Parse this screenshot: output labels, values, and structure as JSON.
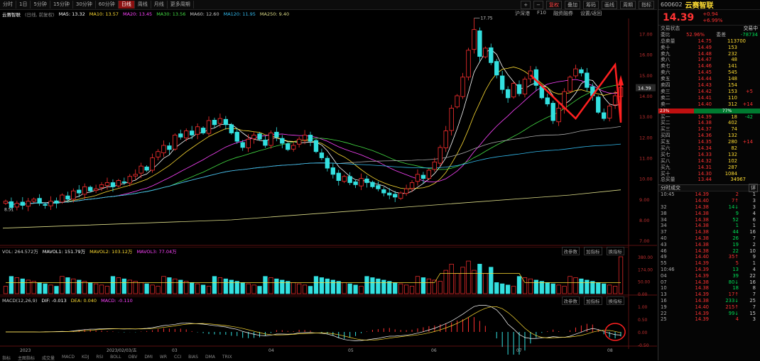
{
  "toolbar": {
    "timeframes": [
      "分时",
      "1日",
      "5分钟",
      "15分钟",
      "30分钟",
      "60分钟",
      "日线",
      "周线",
      "月线",
      "更多周期"
    ],
    "active": "日线",
    "right_buttons": [
      "+",
      "−",
      "复权",
      "叠加",
      "筹码",
      "画线",
      "周期",
      "指标"
    ]
  },
  "sub_tabs": [
    "沪深港",
    "F10",
    "融资融券",
    "设置/返回"
  ],
  "ma_bar": {
    "name": "云赛智联",
    "mode": "(日线, 前复权)",
    "items": [
      {
        "label": "MA5: 13.32",
        "color": "#ffffff"
      },
      {
        "label": "MA10: 13.57",
        "color": "#ffdd33"
      },
      {
        "label": "MA20: 13.45",
        "color": "#ff44ff"
      },
      {
        "label": "MA30: 13.56",
        "color": "#44dd44"
      },
      {
        "label": "MA60: 12.60",
        "color": "#cccccc"
      },
      {
        "label": "MA120: 11.95",
        "color": "#33bbee"
      },
      {
        "label": "MA250: 9.40",
        "color": "#dddd88"
      }
    ]
  },
  "chart_data": {
    "type": "candlestick",
    "price_axis": [
      "17.00",
      "16.00",
      "15.00",
      "14.00",
      "13.00",
      "12.00",
      "11.00",
      "10.00",
      "9.00",
      "8.00",
      "7.00"
    ],
    "ylim": [
      6.8,
      17.6
    ],
    "current_price_label": "14.39",
    "high_label": "17.75",
    "low_marker": "8.51",
    "x_labels": [
      "2023",
      "2023/02/03/五",
      "03",
      "04",
      "05",
      "06",
      "07",
      "08"
    ],
    "closes": [
      8.9,
      8.6,
      8.8,
      8.7,
      8.9,
      9.0,
      8.8,
      8.7,
      8.9,
      8.8,
      9.2,
      9.0,
      9.4,
      9.3,
      9.6,
      9.4,
      9.5,
      9.7,
      9.8,
      9.6,
      9.9,
      9.8,
      10.1,
      10.2,
      10.6,
      10.4,
      11.0,
      11.3,
      11.6,
      11.4,
      12.1,
      12.0,
      12.3,
      12.1,
      12.5,
      12.2,
      12.8,
      12.6,
      12.9,
      12.6,
      12.2,
      11.8,
      11.5,
      11.9,
      12.1,
      11.9,
      11.6,
      12.2,
      12.0,
      11.7,
      11.4,
      11.6,
      11.9,
      12.1,
      11.8,
      11.3,
      11.0,
      10.5,
      10.2,
      9.9,
      10.1,
      9.8,
      9.7,
      10.0,
      9.8,
      9.6,
      9.5,
      9.3,
      9.2,
      9.1,
      9.3,
      9.5,
      9.8,
      10.2,
      10.0,
      10.4,
      10.8,
      11.5,
      12.3,
      13.4,
      14.0,
      14.9,
      16.2,
      17.2,
      15.9,
      16.3,
      15.6,
      15.0,
      14.3,
      13.9,
      14.6,
      14.1,
      14.8,
      15.2,
      14.5,
      13.9,
      13.6,
      12.8,
      13.4,
      14.2,
      14.9,
      15.3,
      15.1,
      14.4,
      14.0,
      13.2,
      12.9,
      13.5,
      14.0,
      14.39
    ],
    "volume_panel": {
      "header": [
        "VOL: 264.572万",
        "MAVOL1: 151.79万",
        "MAVOL2: 103.12万",
        "MAVOL3: 77.04万"
      ],
      "axis": [
        "380.00",
        "174.00",
        "50.00",
        "0.00"
      ]
    },
    "macd_panel": {
      "header": [
        "MACD(12,26,9)",
        "DIF: -0.013",
        "DEA: 0.040",
        "MACD: -0.110"
      ],
      "axis": [
        "1.00",
        "0.50",
        "0.00",
        "-0.50"
      ]
    }
  },
  "panel_buttons": [
    "改参数",
    "加指标",
    "换指标"
  ],
  "bottom_tabs": [
    "指标",
    "主图指标",
    "成交量",
    "MACD",
    "KDJ",
    "RSI",
    "BOLL",
    "OBV",
    "DMI",
    "WR",
    "CCI",
    "BIAS",
    "DMA",
    "TRIX"
  ],
  "right_panel": {
    "code": "600602",
    "name": "云赛智联",
    "price": "14.39",
    "change": "+0.94",
    "change_pct": "+6.99%",
    "status_label": "交易状态",
    "status_value": "交易中",
    "ratio_label": "委比",
    "ratio_value": "52.96%",
    "diff_label": "委差",
    "diff_value": "-78734",
    "sell_total": {
      "label": "总卖量",
      "price": "14.75",
      "vol": "113700"
    },
    "asks": [
      {
        "l": "卖十",
        "p": "14.49",
        "v": "153",
        "c": ""
      },
      {
        "l": "卖九",
        "p": "14.48",
        "v": "232",
        "c": ""
      },
      {
        "l": "卖八",
        "p": "14.47",
        "v": "48",
        "c": ""
      },
      {
        "l": "卖七",
        "p": "14.46",
        "v": "141",
        "c": ""
      },
      {
        "l": "卖六",
        "p": "14.45",
        "v": "545",
        "c": ""
      },
      {
        "l": "卖五",
        "p": "14.44",
        "v": "148",
        "c": ""
      },
      {
        "l": "卖四",
        "p": "14.43",
        "v": "154",
        "c": ""
      },
      {
        "l": "卖三",
        "p": "14.42",
        "v": "153",
        "c": "+5"
      },
      {
        "l": "卖二",
        "p": "14.41",
        "v": "110",
        "c": ""
      },
      {
        "l": "卖一",
        "p": "14.40",
        "v": "312",
        "c": "+14"
      }
    ],
    "bar_left": "23%",
    "bar_right": "77%",
    "bids": [
      {
        "l": "买一",
        "p": "14.39",
        "v": "18",
        "c": "-42"
      },
      {
        "l": "买二",
        "p": "14.38",
        "v": "402",
        "c": ""
      },
      {
        "l": "买三",
        "p": "14.37",
        "v": "74",
        "c": ""
      },
      {
        "l": "买四",
        "p": "14.36",
        "v": "132",
        "c": ""
      },
      {
        "l": "买五",
        "p": "14.35",
        "v": "280",
        "c": "+14"
      },
      {
        "l": "买六",
        "p": "14.34",
        "v": "82",
        "c": ""
      },
      {
        "l": "买七",
        "p": "14.33",
        "v": "132",
        "c": ""
      },
      {
        "l": "买八",
        "p": "14.32",
        "v": "102",
        "c": ""
      },
      {
        "l": "买九",
        "p": "14.31",
        "v": "287",
        "c": ""
      },
      {
        "l": "买十",
        "p": "14.30",
        "v": "1084",
        "c": ""
      }
    ],
    "buy_total": {
      "label": "总买量",
      "price": "13.44",
      "vol": "34967"
    },
    "trades_title": "分时成交",
    "trades_btn": "详",
    "trades": [
      {
        "t": "10:45",
        "p": "14.39",
        "v": "2",
        "n": "1",
        "a": "",
        "pc": "red",
        "vc": "red"
      },
      {
        "t": "",
        "p": "14.40",
        "v": "7",
        "n": "3",
        "a": "↑",
        "pc": "red",
        "vc": "red"
      },
      {
        "t": "32",
        "p": "14.38",
        "v": "14",
        "n": "3",
        "a": "↓",
        "pc": "red",
        "vc": "green"
      },
      {
        "t": "38",
        "p": "14.38",
        "v": "9",
        "n": "4",
        "a": "",
        "pc": "red",
        "vc": "green"
      },
      {
        "t": "34",
        "p": "14.38",
        "v": "52",
        "n": "6",
        "a": "",
        "pc": "red",
        "vc": "green"
      },
      {
        "t": "34",
        "p": "14.38",
        "v": "1",
        "n": "1",
        "a": "",
        "pc": "red",
        "vc": "green"
      },
      {
        "t": "37",
        "p": "14.38",
        "v": "44",
        "n": "16",
        "a": "",
        "pc": "red",
        "vc": "green"
      },
      {
        "t": "40",
        "p": "14.38",
        "v": "26",
        "n": "7",
        "a": "",
        "pc": "red",
        "vc": "green"
      },
      {
        "t": "43",
        "p": "14.38",
        "v": "19",
        "n": "2",
        "a": "",
        "pc": "red",
        "vc": "green"
      },
      {
        "t": "46",
        "p": "14.38",
        "v": "22",
        "n": "10",
        "a": "",
        "pc": "red",
        "vc": "green"
      },
      {
        "t": "49",
        "p": "14.40",
        "v": "35",
        "n": "9",
        "a": "↑",
        "pc": "red",
        "vc": "red"
      },
      {
        "t": "55",
        "p": "14.39",
        "v": "5",
        "n": "1",
        "a": "",
        "pc": "red",
        "vc": "red"
      },
      {
        "t": "10:46",
        "p": "14.39",
        "v": "13",
        "n": "4",
        "a": "",
        "pc": "red",
        "vc": "green"
      },
      {
        "t": "04",
        "p": "14.39",
        "v": "39",
        "n": "22",
        "a": "",
        "pc": "red",
        "vc": "green"
      },
      {
        "t": "07",
        "p": "14.38",
        "v": "80",
        "n": "16",
        "a": "↓",
        "pc": "red",
        "vc": "green"
      },
      {
        "t": "10",
        "p": "14.38",
        "v": "18",
        "n": "8",
        "a": "",
        "pc": "red",
        "vc": "green"
      },
      {
        "t": "13",
        "p": "14.39",
        "v": "17",
        "n": "7",
        "a": "↑",
        "pc": "red",
        "vc": "red"
      },
      {
        "t": "16",
        "p": "14.38",
        "v": "233",
        "n": "25",
        "a": "↓",
        "pc": "red",
        "vc": "green"
      },
      {
        "t": "19",
        "p": "14.40",
        "v": "215",
        "n": "7",
        "a": "↑",
        "pc": "red",
        "vc": "red"
      },
      {
        "t": "22",
        "p": "14.39",
        "v": "99",
        "n": "15",
        "a": "↓",
        "pc": "red",
        "vc": "green"
      },
      {
        "t": "25",
        "p": "14.39",
        "v": "4",
        "n": "3",
        "a": "",
        "pc": "red",
        "vc": "red"
      }
    ]
  }
}
